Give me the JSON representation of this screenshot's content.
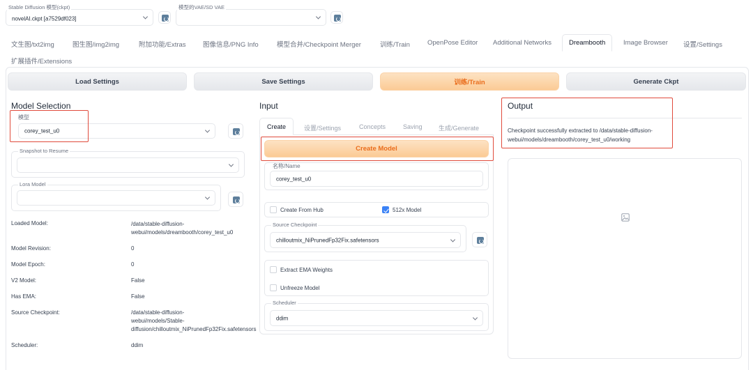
{
  "top": {
    "ckpt_label": "Stable Diffusion 模型(ckpt)",
    "ckpt_value": "novelAI.ckpt [a7529df023]",
    "vae_label": "模型的VAE/SD VAE",
    "vae_value": ""
  },
  "nav": {
    "tabs": [
      "文生图/txt2img",
      "图生图/img2img",
      "附加功能/Extras",
      "图像信息/PNG Info",
      "模型合并/Checkpoint Merger",
      "训练/Train",
      "OpenPose Editor",
      "Additional Networks",
      "Dreambooth",
      "Image Browser",
      "设置/Settings",
      "扩展插件/Extensions"
    ],
    "active": "Dreambooth"
  },
  "actions": {
    "load": "Load Settings",
    "save": "Save Settings",
    "train": "训练/Train",
    "generate": "Generate Ckpt"
  },
  "model_selection": {
    "title": "Model Selection",
    "model_label": "模型",
    "model_value": "corey_test_u0",
    "snapshot_label": "Snapshot to Resume",
    "snapshot_value": "",
    "lora_label": "Lora Model",
    "lora_value": "",
    "info": [
      {
        "key": "Loaded Model:",
        "lines": [
          "/data/stable-diffusion-",
          "webui/models/dreambooth/corey_test_u0"
        ]
      },
      {
        "key": "Model Revision:",
        "lines": [
          "0"
        ]
      },
      {
        "key": "Model Epoch:",
        "lines": [
          "0"
        ]
      },
      {
        "key": "V2 Model:",
        "lines": [
          "False"
        ]
      },
      {
        "key": "Has EMA:",
        "lines": [
          "False"
        ]
      },
      {
        "key": "Source Checkpoint:",
        "lines": [
          "/data/stable-diffusion-",
          "webui/models/Stable-",
          "diffusion/chilloutmix_NiPrunedFp32Fix.safetensors"
        ]
      },
      {
        "key": "Scheduler:",
        "lines": [
          "ddim"
        ]
      }
    ]
  },
  "input": {
    "title": "Input",
    "tabs": [
      "Create",
      "设置/Settings",
      "Concepts",
      "Saving",
      "生成/Generate"
    ],
    "active_tab": "Create",
    "create_button": "Create Model",
    "name_label": "名称/Name",
    "name_value": "corey_test_u0",
    "create_from_hub": {
      "label": "Create From Hub",
      "checked": false
    },
    "model_512x": {
      "label": "512x Model",
      "checked": true
    },
    "source_label": "Source Checkpoint",
    "source_value": "chilloutmix_NiPrunedFp32Fix.safetensors",
    "extract_ema": {
      "label": "Extract EMA Weights",
      "checked": false
    },
    "unfreeze": {
      "label": "Unfreeze Model",
      "checked": false
    },
    "scheduler_label": "Scheduler",
    "scheduler_value": "ddim"
  },
  "output": {
    "title": "Output",
    "message_lines": [
      "Checkpoint successfully extracted to /data/stable-diffusion-",
      "webui/models/dreambooth/corey_test_u0/working"
    ],
    "image_icon": "image-placeholder-icon"
  },
  "colors": {
    "accent_orange": "#ea6d1c",
    "annotation_red": "#e04b3c",
    "checkbox_blue": "#3b82f6"
  }
}
